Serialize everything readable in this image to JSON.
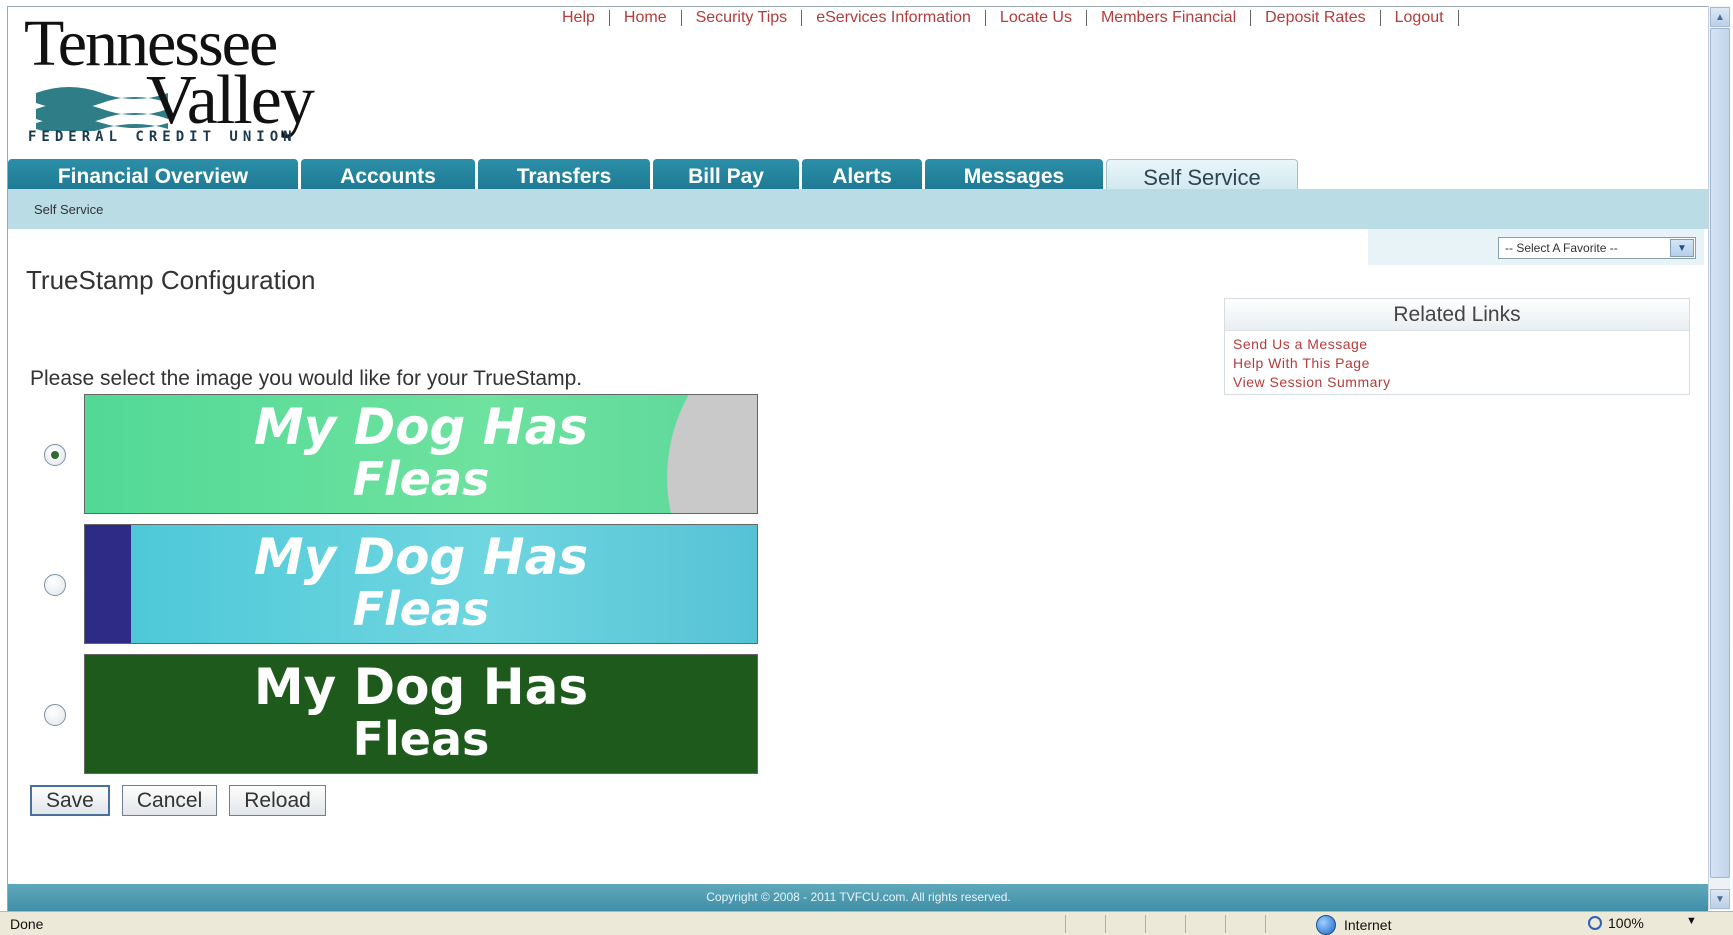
{
  "logo": {
    "line1": "Tennessee",
    "line2": "Valley",
    "line3": "FEDERAL CREDIT UNION"
  },
  "top_links": [
    "Help",
    "Home",
    "Security Tips",
    "eServices Information",
    "Locate Us",
    "Members Financial",
    "Deposit Rates",
    "Logout"
  ],
  "tabs": [
    {
      "label": "Financial Overview",
      "active": false
    },
    {
      "label": "Accounts",
      "active": false
    },
    {
      "label": "Transfers",
      "active": false
    },
    {
      "label": "Bill Pay",
      "active": false
    },
    {
      "label": "Alerts",
      "active": false
    },
    {
      "label": "Messages",
      "active": false
    },
    {
      "label": "Self Service",
      "active": true
    }
  ],
  "breadcrumb": "Self Service",
  "favorite_select": {
    "selected": "-- Select A Favorite --"
  },
  "page_title": "TrueStamp Configuration",
  "prompt": "Please select the image you would like for your TrueStamp.",
  "stamps": [
    {
      "line1": "My Dog Has",
      "line2": "Fleas",
      "selected": true
    },
    {
      "line1": "My Dog Has",
      "line2": "Fleas",
      "selected": false
    },
    {
      "line1": "My Dog Has",
      "line2": "Fleas",
      "selected": false
    }
  ],
  "buttons": {
    "save": "Save",
    "cancel": "Cancel",
    "reload": "Reload"
  },
  "related_links": {
    "title": "Related Links",
    "items": [
      "Send Us a Message",
      "Help With This Page",
      "View Session Summary"
    ]
  },
  "footer": "Copyright © 2008 - 2011 TVFCU.com. All rights reserved.",
  "statusbar": {
    "status": "Done",
    "zone": "Internet",
    "zoom": "100%"
  },
  "colors": {
    "tab": "#1d7690",
    "subnav": "#b9dce5",
    "link": "#b43c3c",
    "footer": "#3f8ea6"
  }
}
